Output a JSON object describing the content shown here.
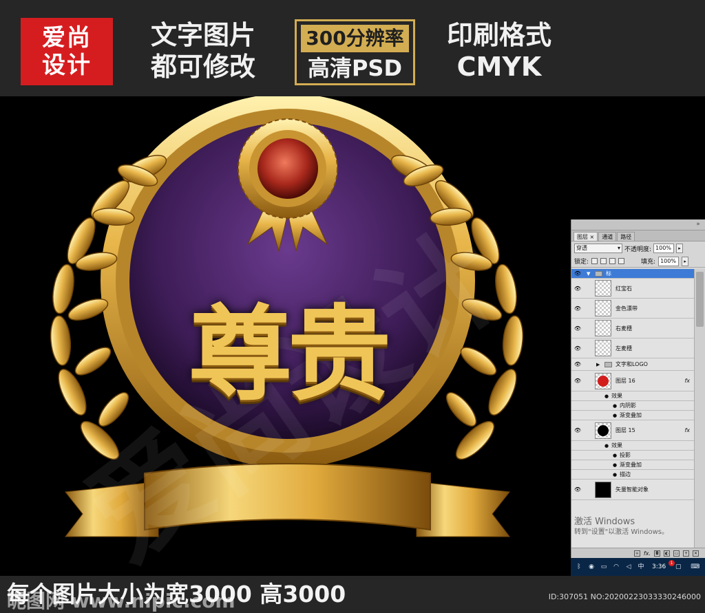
{
  "banner": {
    "brand_line1": "爱尚",
    "brand_line2": "设计",
    "feature1_line1": "文字图片",
    "feature1_line2": "都可修改",
    "quality_top": "300分辨率",
    "quality_bottom": "高清PSD",
    "feature3_line1": "印刷格式",
    "feature3_line2": "CMYK",
    "brand_color": "#d51d20",
    "accent_color": "#d3ad52"
  },
  "artwork": {
    "badge_title": "尊贵",
    "disc_color": "#4a2466",
    "gold_color": "#e8b64a",
    "gem_color": "#a8281c"
  },
  "ps_panel": {
    "tabs": [
      "图层 ×",
      "通道",
      "路径"
    ],
    "blend_mode": "穿透",
    "opacity_label": "不透明度:",
    "opacity_value": "100%",
    "lock_label": "锁定:",
    "fill_label": "填充:",
    "fill_value": "100%",
    "layers": [
      {
        "name": "标",
        "type": "group-open",
        "selected": true
      },
      {
        "name": "红宝石",
        "type": "layer"
      },
      {
        "name": "金色漂带",
        "type": "layer"
      },
      {
        "name": "右麦穗",
        "type": "layer"
      },
      {
        "name": "左麦穗",
        "type": "layer"
      },
      {
        "name": "文字和LOGO",
        "type": "group-closed"
      },
      {
        "name": "图层 16",
        "type": "layer-fx",
        "fx": "fx"
      },
      {
        "name": "效果",
        "type": "effects-header"
      },
      {
        "name": "内阴影",
        "type": "effect"
      },
      {
        "name": "渐变叠加",
        "type": "effect"
      },
      {
        "name": "图层 15",
        "type": "layer-fx",
        "fx": "fx"
      },
      {
        "name": "效果",
        "type": "effects-header"
      },
      {
        "name": "投影",
        "type": "effect"
      },
      {
        "name": "渐变叠加",
        "type": "effect"
      },
      {
        "name": "描边",
        "type": "effect"
      },
      {
        "name": "矢量智能对象",
        "type": "layer-solid"
      }
    ],
    "activate_line1": "激活 Windows",
    "activate_line2": "转到\"设置\"以激活 Windows。",
    "bottom_fx": "fx."
  },
  "taskbar": {
    "time": "3:36",
    "notification_count": "1"
  },
  "bottom": {
    "caption": "每个图片大小为宽3000 高3000",
    "site": "昵图网 www.nipic.com",
    "image_id": "ID:307051 NO:20200223033330246000"
  }
}
